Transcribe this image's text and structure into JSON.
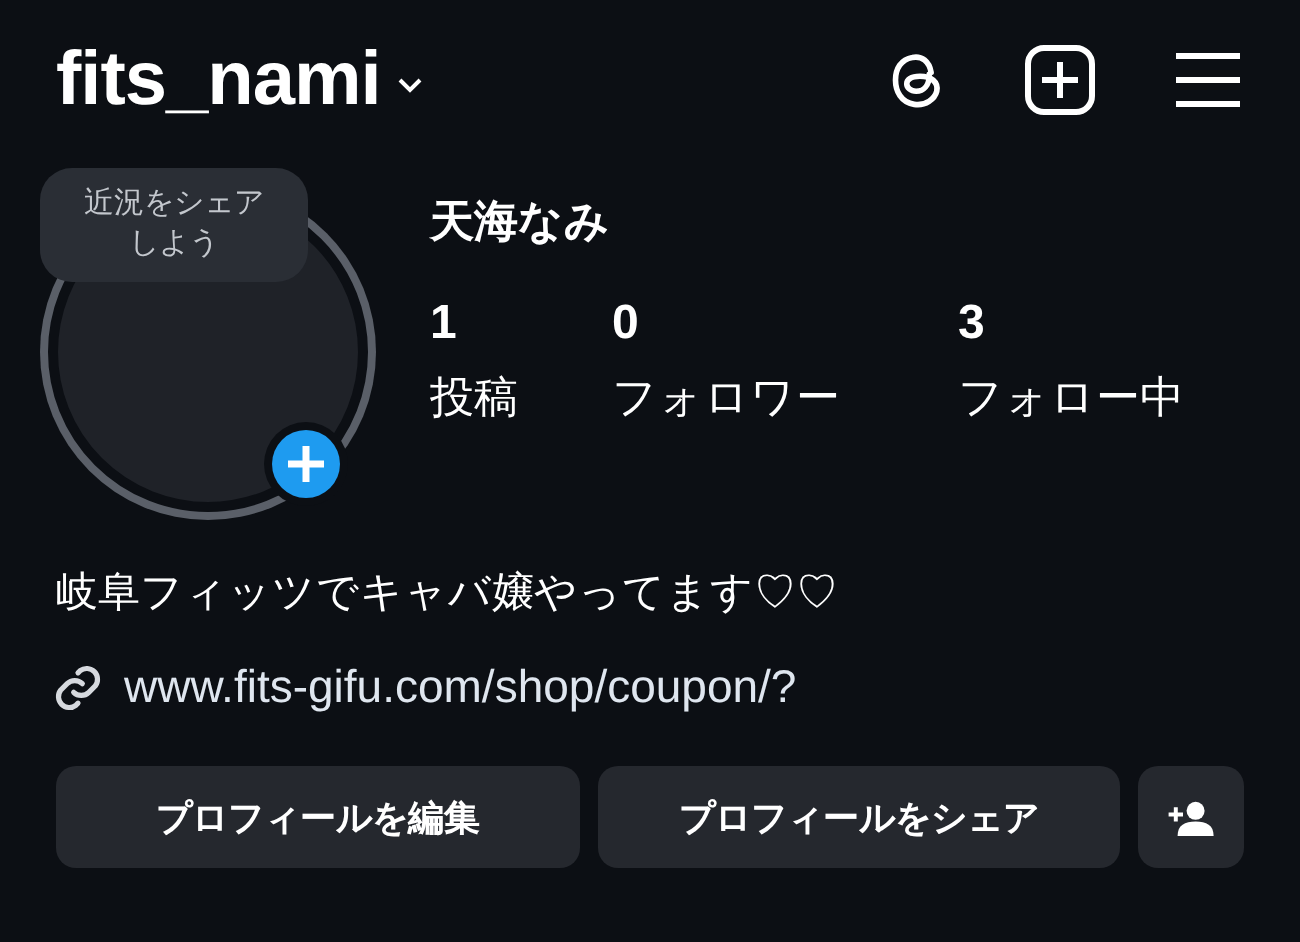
{
  "header": {
    "username": "fits_nami"
  },
  "avatar": {
    "note": "近況をシェアしよう"
  },
  "profile": {
    "name": "天海なみ"
  },
  "stats": [
    {
      "count": "1",
      "label": "投稿"
    },
    {
      "count": "0",
      "label": "フォロワー"
    },
    {
      "count": "3",
      "label": "フォロー中"
    }
  ],
  "bio": "岐阜フィッツでキャバ嬢やってます♡♡",
  "link": "www.fits-gifu.com/shop/coupon/?",
  "buttons": [
    {
      "kind": "text",
      "label": "プロフィールを編集"
    },
    {
      "kind": "text",
      "label": "プロフィールをシェア"
    },
    {
      "kind": "add-person"
    }
  ]
}
